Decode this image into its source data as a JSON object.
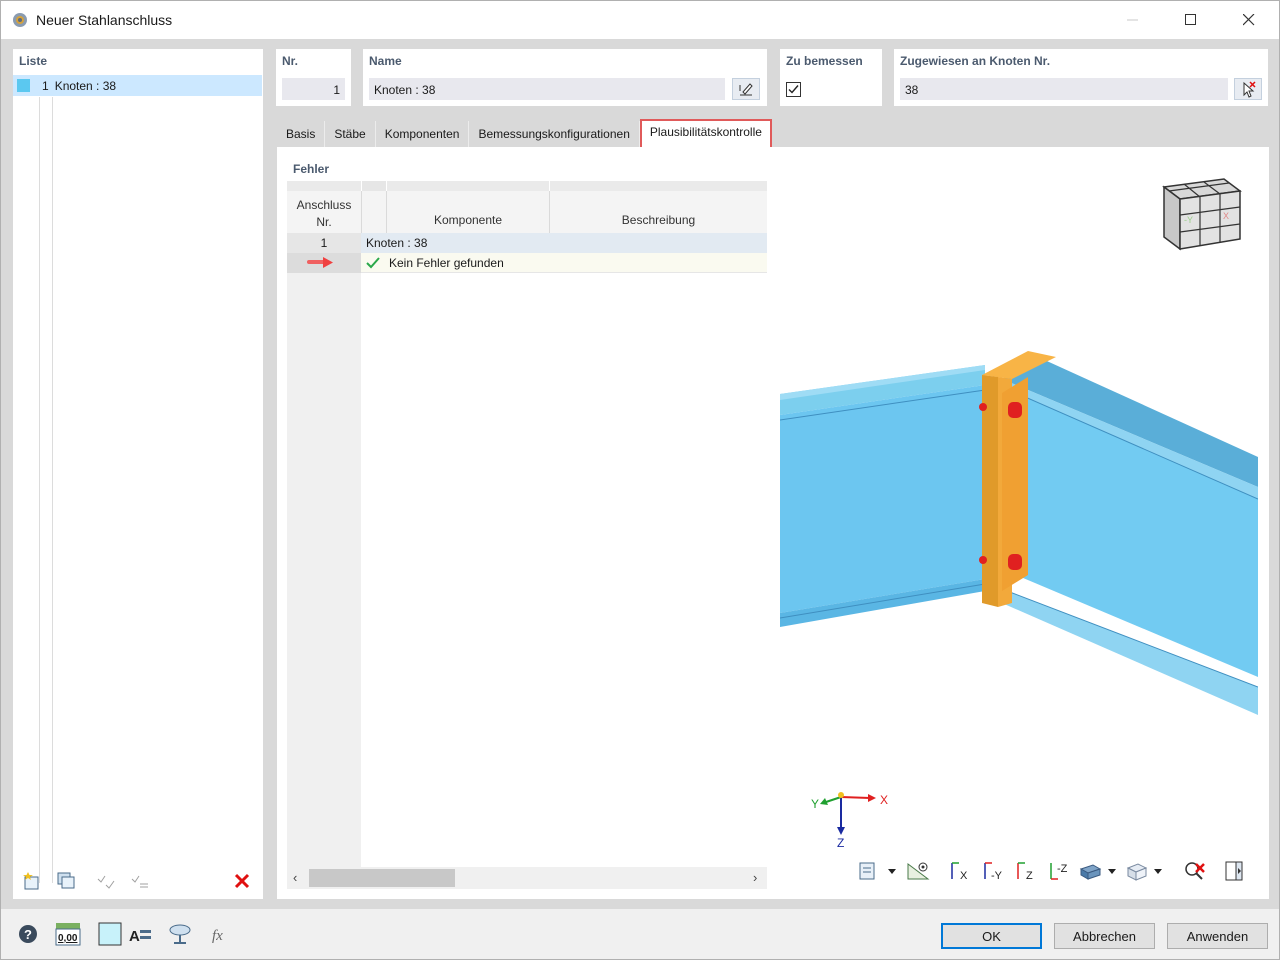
{
  "window": {
    "title": "Neuer Stahlanschluss"
  },
  "list": {
    "header": "Liste",
    "items": [
      {
        "number": "1",
        "label": "Knoten : 38",
        "color": "#5bc8f0"
      }
    ]
  },
  "fields": {
    "nr": {
      "label": "Nr.",
      "value": "1"
    },
    "name": {
      "label": "Name",
      "value": "Knoten : 38"
    },
    "zu_bemessen": {
      "label": "Zu bemessen",
      "checked": true
    },
    "zugewiesen": {
      "label": "Zugewiesen an Knoten Nr.",
      "value": "38"
    }
  },
  "tabs": [
    {
      "label": "Basis"
    },
    {
      "label": "Stäbe"
    },
    {
      "label": "Komponenten"
    },
    {
      "label": "Bemessungskonfigurationen"
    },
    {
      "label": "Plausibilitätskontrolle",
      "active": true
    }
  ],
  "errors": {
    "header": "Fehler",
    "columns": {
      "anschluss_line1": "Anschluss",
      "anschluss_line2": "Nr.",
      "komponente": "Komponente",
      "beschreibung": "Beschreibung"
    },
    "group": {
      "number": "1",
      "label": "Knoten : 38"
    },
    "rows": [
      {
        "icon": "check-icon",
        "text": "Kein Fehler gefunden"
      }
    ]
  },
  "view": {
    "axes": {
      "x": "X",
      "y": "Y",
      "z": "Z"
    },
    "cube_labels": {
      "front": "-Y",
      "side": "X"
    }
  },
  "buttons": {
    "ok": "OK",
    "abbrechen": "Abbrechen",
    "anwenden": "Anwenden"
  },
  "bottom_icons": {
    "units_value": "0,00"
  },
  "colors": {
    "accent_tab_border": "#e05a5a",
    "beam_blue": "#6cc6f0",
    "plate_orange": "#f2a93b",
    "bolt_red": "#e02020",
    "header_text": "#4b5a6e"
  }
}
